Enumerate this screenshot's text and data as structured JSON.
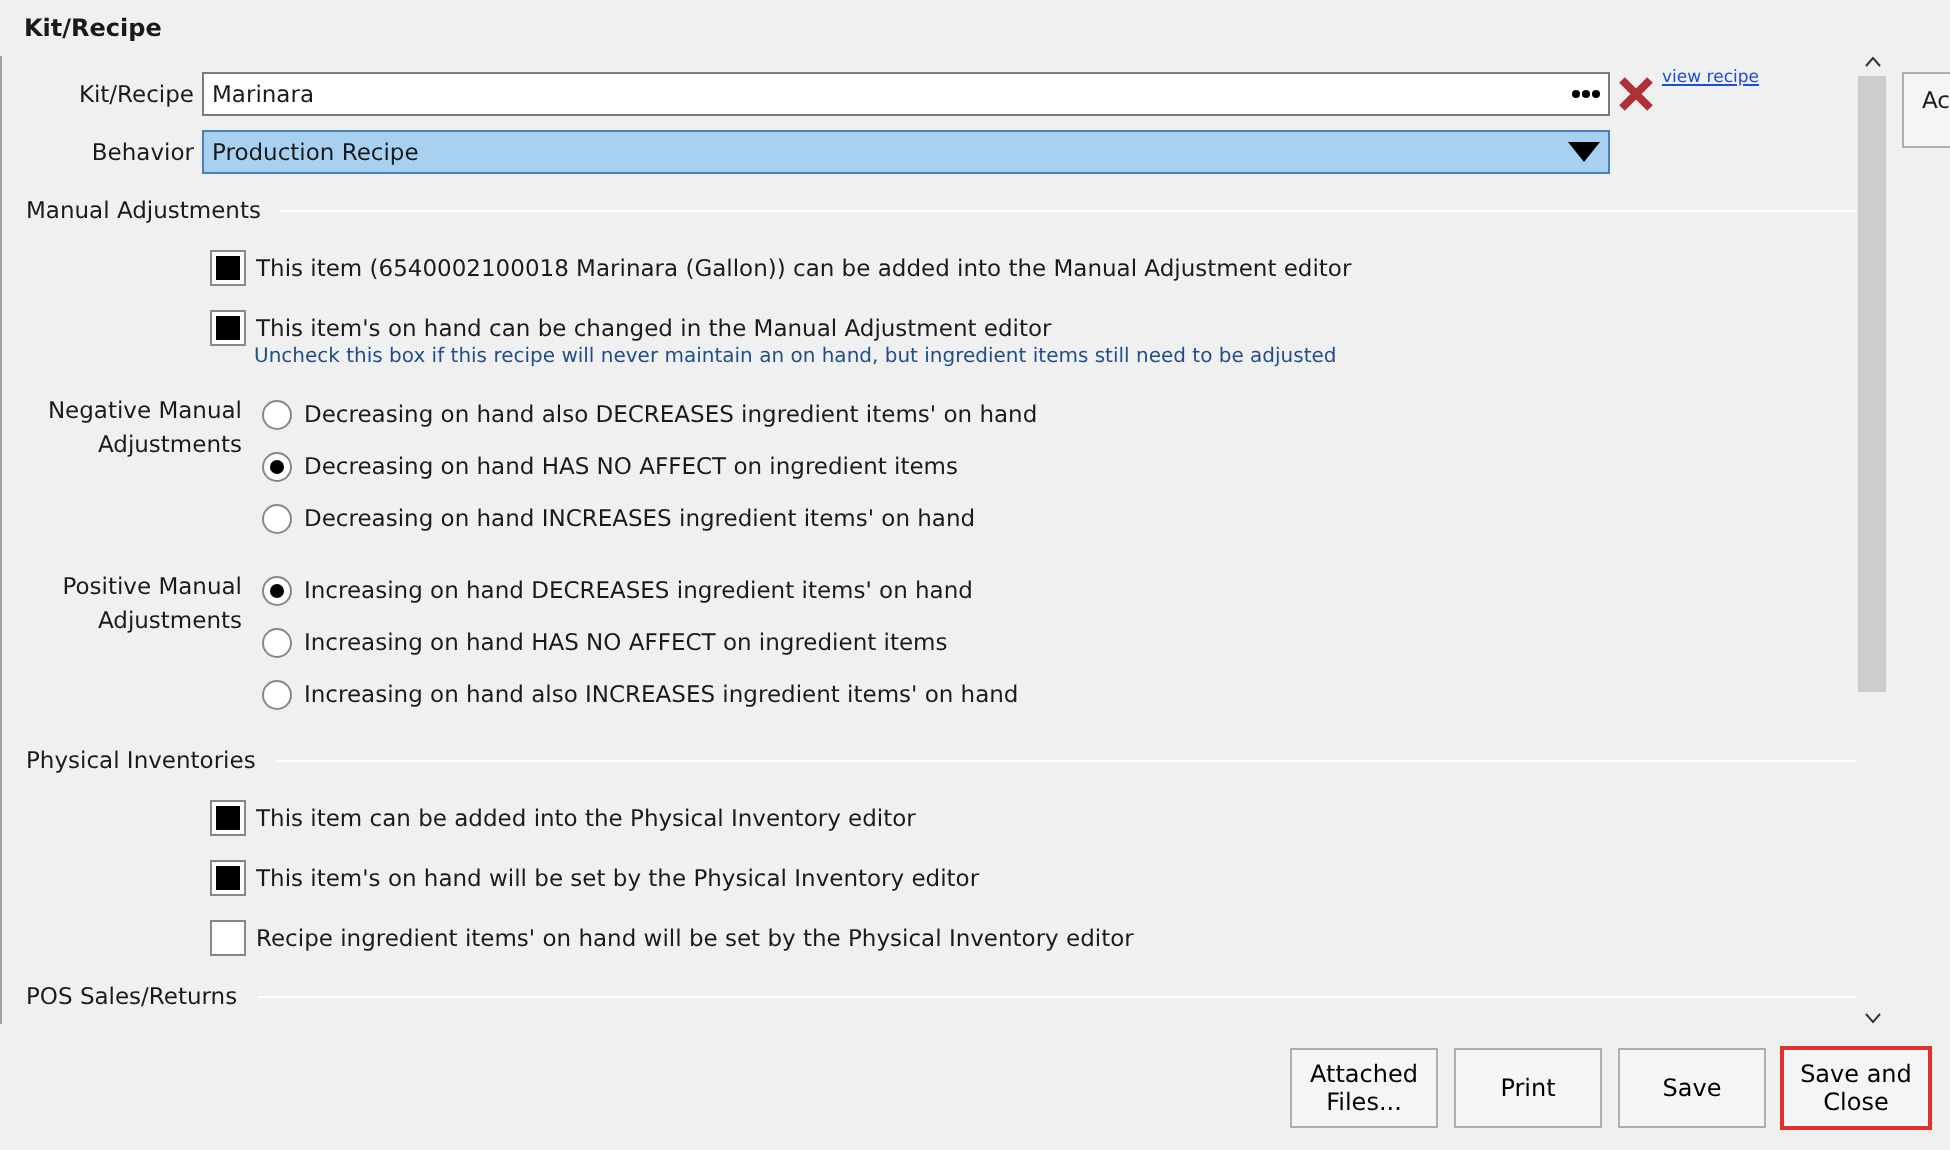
{
  "header": "Kit/Recipe",
  "fields": [
    {
      "kind": "lookup",
      "label": "Kit/Recipe",
      "value": "Marinara",
      "link": "view recipe"
    },
    {
      "kind": "select",
      "label": "Behavior",
      "value": "Production Recipe"
    }
  ],
  "sections": [
    {
      "title": "Manual Adjustments",
      "items": [
        {
          "kind": "checkbox",
          "label": "This item (6540002100018 Marinara (Gallon)) can be added into the Manual Adjustment editor",
          "checked": true
        },
        {
          "kind": "checkbox",
          "label": "This item's on hand can be changed in the Manual Adjustment editor",
          "checked": true,
          "hint": "Uncheck this box if this recipe will never maintain an on hand, but ingredient items still need to be adjusted"
        },
        {
          "kind": "radios",
          "label": "Negative Manual Adjustments",
          "options": [
            {
              "label": "Decreasing on hand also DECREASES ingredient items' on hand",
              "selected": false
            },
            {
              "label": "Decreasing on hand HAS NO AFFECT on ingredient items",
              "selected": true
            },
            {
              "label": "Decreasing on hand INCREASES ingredient items' on hand",
              "selected": false
            }
          ]
        },
        {
          "kind": "radios",
          "label": "Positive Manual Adjustments",
          "options": [
            {
              "label": "Increasing on hand DECREASES ingredient items' on hand",
              "selected": true
            },
            {
              "label": "Increasing on hand HAS NO AFFECT on ingredient items",
              "selected": false
            },
            {
              "label": "Increasing on hand also INCREASES ingredient items' on hand",
              "selected": false
            }
          ]
        }
      ]
    },
    {
      "title": "Physical Inventories",
      "items": [
        {
          "kind": "checkbox",
          "label": "This item can be added into the Physical Inventory editor",
          "checked": true
        },
        {
          "kind": "checkbox",
          "label": "This item's on hand will be set by the Physical Inventory editor",
          "checked": true
        },
        {
          "kind": "checkbox",
          "label": "Recipe ingredient items' on hand will be set by the Physical Inventory editor",
          "checked": false
        }
      ]
    },
    {
      "title": "POS Sales/Returns"
    }
  ],
  "side_button": "Ac",
  "buttons": [
    {
      "label": "Attached Files...",
      "highlighted": false
    },
    {
      "label": "Print",
      "highlighted": false
    },
    {
      "label": "Save",
      "highlighted": false
    },
    {
      "label": "Save and Close",
      "highlighted": true
    }
  ]
}
